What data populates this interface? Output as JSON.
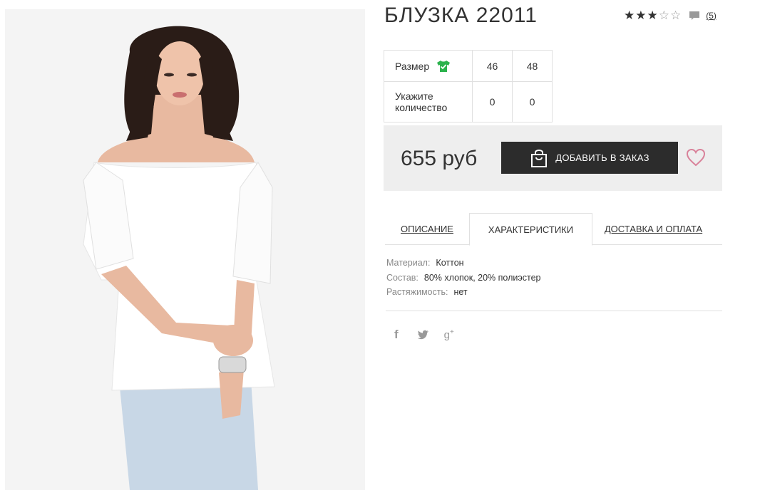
{
  "product": {
    "title": "БЛУЗКА 22011",
    "rating": 3,
    "rating_max": 5,
    "review_count": "(5)"
  },
  "size_table": {
    "size_label": "Размер",
    "qty_label": "Укажите количество",
    "sizes": [
      "46",
      "48"
    ],
    "quantities": [
      "0",
      "0"
    ]
  },
  "purchase": {
    "price": "655 руб",
    "add_button_label": "ДОБАВИТЬ В ЗАКАЗ"
  },
  "tabs": [
    {
      "label": "ОПИСАНИЕ",
      "active": false
    },
    {
      "label": "ХАРАКТЕРИСТИКИ",
      "active": true
    },
    {
      "label": "ДОСТАВКА И ОПЛАТА",
      "active": false
    }
  ],
  "specs": [
    {
      "key": "Материал:",
      "value": "Коттон"
    },
    {
      "key": "Состав:",
      "value": "80% хлопок, 20% полиэстер"
    },
    {
      "key": "Растяжимость:",
      "value": "нет"
    }
  ],
  "social": {
    "icons": [
      "facebook-icon",
      "twitter-icon",
      "google-plus-icon"
    ],
    "facebook_glyph": "f",
    "google_glyph": "g",
    "google_sup": "+"
  },
  "colors": {
    "button_bg": "#2c2c2c",
    "buy_box_bg": "#eeeeee",
    "heart": "#d9829a",
    "tshirt": "#2bb24c"
  }
}
